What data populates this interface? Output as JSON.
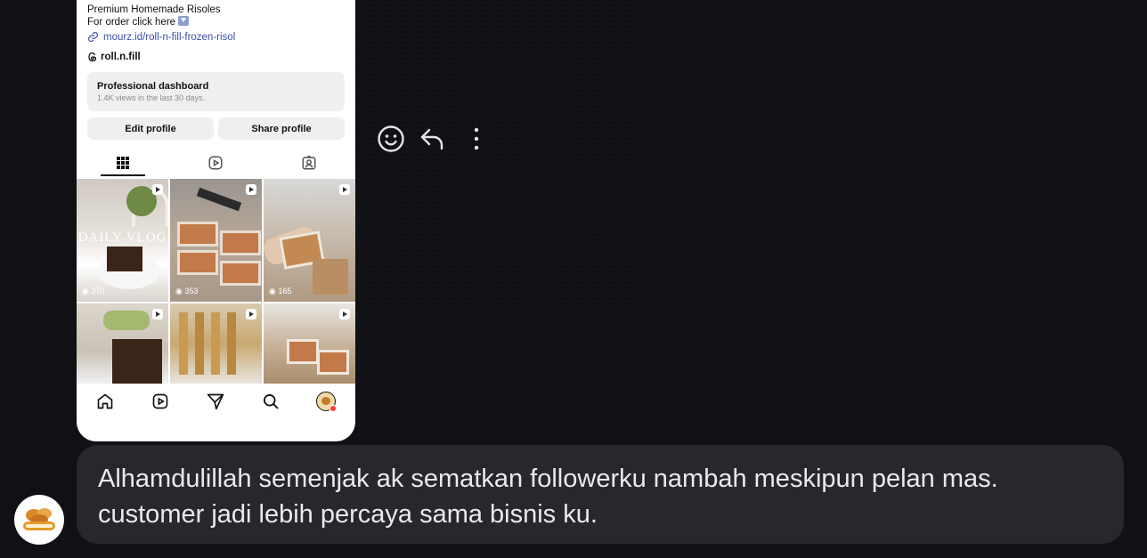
{
  "profile": {
    "bio_line1": "Premium Homemade Risoles",
    "bio_line2": "For order click here",
    "link": "mourz.id/roll-n-fill-frozen-risol",
    "threads": "roll.n.fill",
    "dashboard_title": "Professional dashboard",
    "dashboard_sub": "1.4K views in the last 30 days.",
    "edit_label": "Edit profile",
    "share_label": "Share profile",
    "tabs": [
      "grid-icon",
      "reels-icon",
      "tagged-icon"
    ],
    "posts": [
      {
        "views": "370",
        "overlay": "DAILY VLOG"
      },
      {
        "views": "353",
        "overlay": ""
      },
      {
        "views": "165",
        "overlay": ""
      },
      {
        "views": "",
        "overlay": ""
      },
      {
        "views": "",
        "overlay": ""
      },
      {
        "views": "",
        "overlay": ""
      }
    ],
    "bottom_nav": [
      "home-icon",
      "reels-icon",
      "send-icon",
      "search-icon",
      "profile-avatar"
    ]
  },
  "actions": [
    "emoji-icon",
    "reply-icon",
    "more-icon"
  ],
  "message": {
    "text": "Alhamdulillah semenjak ak sematkan followerku nambah meskipun pelan mas. customer jadi lebih percaya sama bisnis ku.",
    "avatar_label": "Roll n Fill"
  },
  "colors": {
    "background": "#0f1115",
    "bubble": "#26282d",
    "text": "#eaeaea",
    "link": "#3a4fa8"
  }
}
